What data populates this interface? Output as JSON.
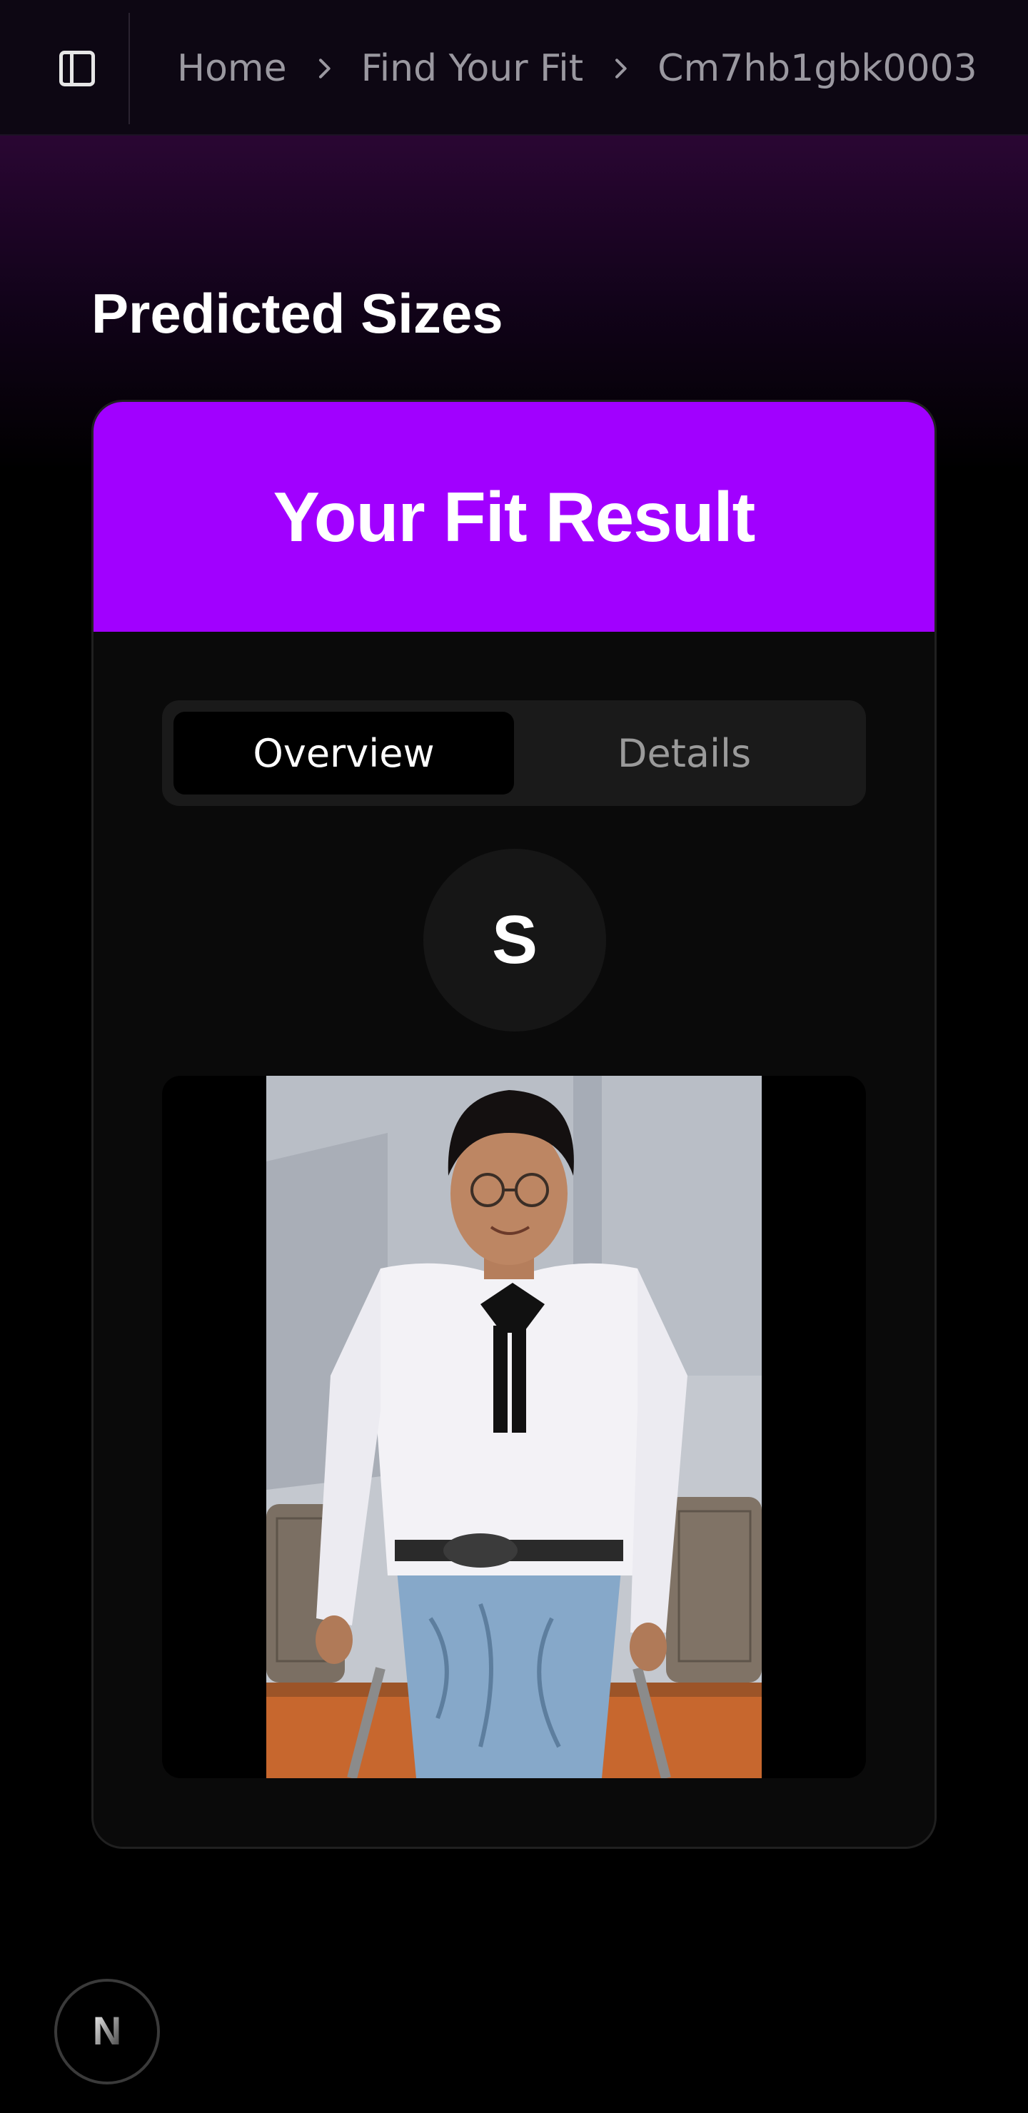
{
  "header": {
    "sidebar_toggle_icon": "sidebar-panel-icon",
    "breadcrumb": {
      "items": [
        "Home",
        "Find Your Fit",
        "Cm7hb1gbk0003"
      ],
      "separator_icon": "chevron-right-icon"
    }
  },
  "main": {
    "title": "Predicted Sizes",
    "card": {
      "title": "Your Fit Result",
      "accent_color": "#a100ff",
      "tabs": [
        {
          "label": "Overview",
          "active": true
        },
        {
          "label": "Details",
          "active": false
        }
      ],
      "predicted_size": "S",
      "photo_icon": "person-photo"
    }
  },
  "footer": {
    "badge_letter": "N",
    "badge_icon": "nextjs-logo-icon"
  }
}
